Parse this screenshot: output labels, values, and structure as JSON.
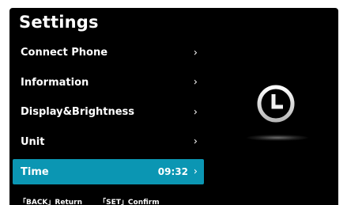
{
  "header": {
    "title": "Settings"
  },
  "menu": {
    "items": [
      {
        "label": "Connect Phone",
        "chevron": "›"
      },
      {
        "label": "Information",
        "chevron": "›"
      },
      {
        "label": "Display&Brightness",
        "chevron": "›"
      },
      {
        "label": "Unit",
        "chevron": "›"
      },
      {
        "label": "Time",
        "value": "09:32",
        "chevron": "›",
        "selected": true
      }
    ]
  },
  "footer": {
    "back_hint": "「BACK」Return",
    "set_hint": "「SET」Confirm"
  },
  "preview": {
    "icon": "clock-icon"
  },
  "colors": {
    "background": "#000000",
    "accent": "#0b96b3",
    "text": "#ffffff"
  }
}
